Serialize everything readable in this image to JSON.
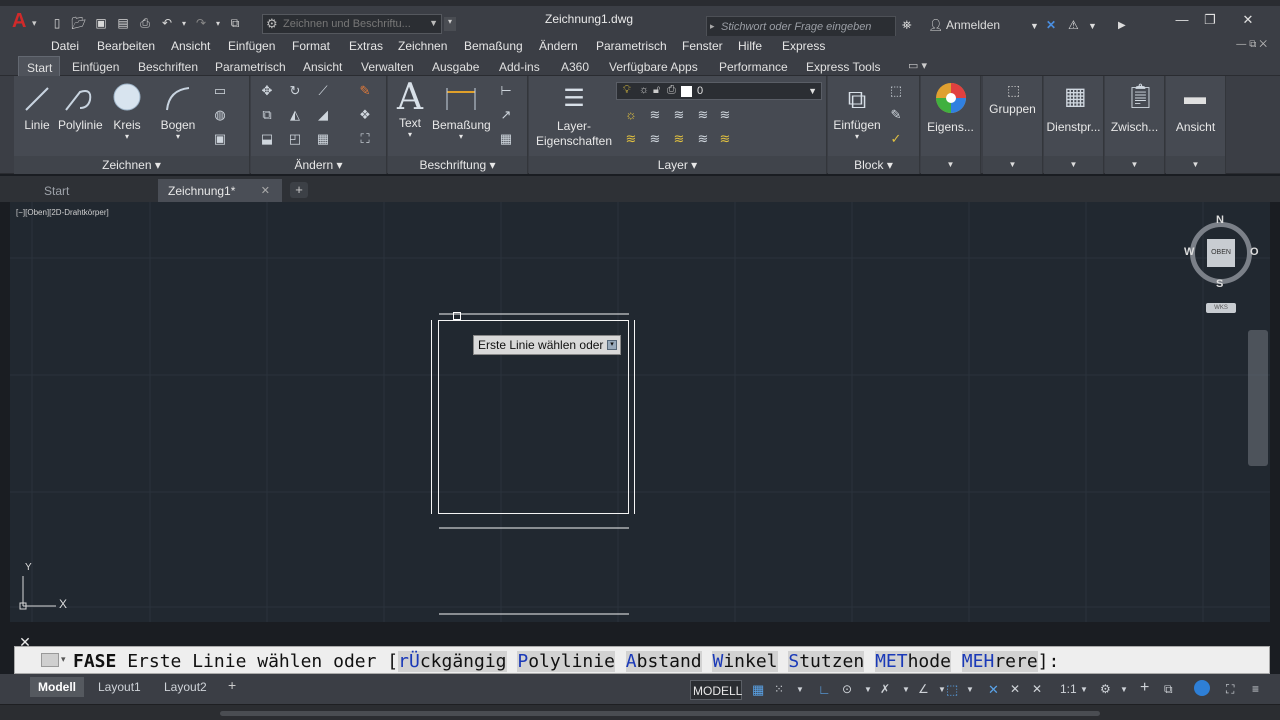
{
  "title_bar": {
    "document_title": "Zeichnung1.dwg",
    "workspace_placeholder": "Zeichnen und Beschriftu...",
    "search_placeholder": "Stichwort oder Frage eingeben",
    "signin_label": "Anmelden"
  },
  "menu": [
    "Datei",
    "Bearbeiten",
    "Ansicht",
    "Einfügen",
    "Format",
    "Extras",
    "Zeichnen",
    "Bemaßung",
    "Ändern",
    "Parametrisch",
    "Fenster",
    "Hilfe",
    "Express"
  ],
  "ribbon_tabs": [
    "Start",
    "Einfügen",
    "Beschriften",
    "Parametrisch",
    "Ansicht",
    "Verwalten",
    "Ausgabe",
    "Add-ins",
    "A360",
    "Verfügbare Apps",
    "Performance",
    "Express Tools"
  ],
  "ribbon": {
    "panels": {
      "zeichnen": "Zeichnen",
      "aendern": "Ändern",
      "beschriftung": "Beschriftung",
      "layer": "Layer",
      "block": "Block"
    },
    "buttons": {
      "linie": "Linie",
      "polylinie": "Polylinie",
      "kreis": "Kreis",
      "bogen": "Bogen",
      "text": "Text",
      "bemassung": "Bemaßung",
      "layer_eig_1": "Layer-",
      "layer_eig_2": "Eigenschaften",
      "einfuegen": "Einfügen",
      "eigens": "Eigens...",
      "gruppen": "Gruppen",
      "dienstpr": "Dienstpr...",
      "zwisch": "Zwisch...",
      "ansicht": "Ansicht"
    },
    "layer_value": "0"
  },
  "file_tabs": {
    "start": "Start",
    "drawing": "Zeichnung1*"
  },
  "viewport": {
    "label": "[−][Oben][2D-Drahtkörper]",
    "tooltip": "Erste Linie wählen oder",
    "compass": {
      "n": "N",
      "s": "S",
      "w": "W",
      "o": "O",
      "center": "OBEN",
      "wcs": "WKS"
    },
    "ucs": {
      "x": "X",
      "y": "Y"
    }
  },
  "command": {
    "name": "FASE",
    "text": "Erste Linie wählen oder [",
    "options": [
      {
        "key": "rÜ",
        "rest": "ckgängig"
      },
      {
        "key": "P",
        "rest": "olylinie"
      },
      {
        "key": "A",
        "rest": "bstand"
      },
      {
        "key": "W",
        "rest": "inkel"
      },
      {
        "key": "S",
        "rest": "tutzen"
      },
      {
        "key": "MET",
        "rest": "hode"
      },
      {
        "key": "MEH",
        "rest": "rere"
      }
    ],
    "end": "]:"
  },
  "layout_tabs": [
    "Modell",
    "Layout1",
    "Layout2"
  ],
  "status": {
    "model": "MODELL",
    "scale": "1:1"
  }
}
